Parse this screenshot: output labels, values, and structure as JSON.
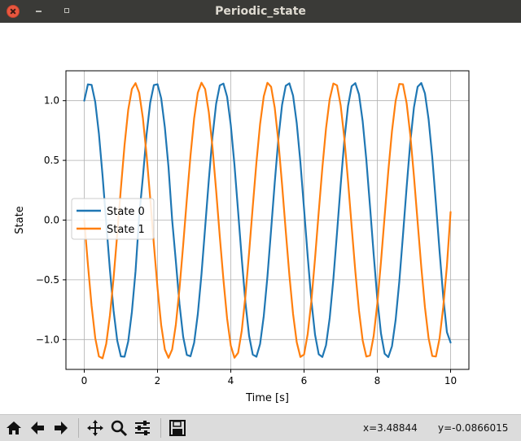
{
  "window": {
    "title": "Periodic_state"
  },
  "toolbar": {
    "x_readout": "x=3.48844",
    "y_readout": "y=-0.0866015",
    "buttons": [
      "home-icon",
      "back-icon",
      "forward-icon",
      "pan-icon",
      "zoom-icon",
      "configure-subplots-icon",
      "save-icon"
    ]
  },
  "chart_data": {
    "type": "line",
    "title": "",
    "xlabel": "Time [s]",
    "ylabel": "State",
    "xlim": [
      -0.5,
      10.5
    ],
    "ylim": [
      -1.25,
      1.25
    ],
    "xticks": [
      0,
      2,
      4,
      6,
      8,
      10
    ],
    "xtick_labels": [
      "0",
      "2",
      "4",
      "6",
      "8",
      "10"
    ],
    "yticks": [
      -1.0,
      -0.5,
      0.0,
      0.5,
      1.0
    ],
    "ytick_labels": [
      "−1.0",
      "−0.5",
      "0.0",
      "0.5",
      "1.0"
    ],
    "grid": true,
    "legend_position": "center-left",
    "colors": {
      "State 0": "#1f77b4",
      "State 1": "#ff7f0e"
    },
    "x": [
      0.0,
      0.1,
      0.2,
      0.3,
      0.4,
      0.5,
      0.6,
      0.7,
      0.8,
      0.9,
      1.0,
      1.1,
      1.2,
      1.3,
      1.4,
      1.5,
      1.6,
      1.7,
      1.8,
      1.9,
      2.0,
      2.1,
      2.2,
      2.3,
      2.4,
      2.5,
      2.6,
      2.7,
      2.8,
      2.9,
      3.0,
      3.1,
      3.2,
      3.3,
      3.4,
      3.5,
      3.6,
      3.7,
      3.8,
      3.9,
      4.0,
      4.1,
      4.2,
      4.3,
      4.4,
      4.5,
      4.6,
      4.7,
      4.8,
      4.9,
      5.0,
      5.1,
      5.2,
      5.3,
      5.4,
      5.5,
      5.6,
      5.7,
      5.8,
      5.9,
      6.0,
      6.1,
      6.2,
      6.3,
      6.4,
      6.5,
      6.6,
      6.7,
      6.8,
      6.9,
      7.0,
      7.1,
      7.2,
      7.3,
      7.4,
      7.5,
      7.6,
      7.7,
      7.8,
      7.9,
      8.0,
      8.1,
      8.2,
      8.3,
      8.4,
      8.5,
      8.6,
      8.7,
      8.8,
      8.9,
      9.0,
      9.1,
      9.2,
      9.3,
      9.4,
      9.5,
      9.6,
      9.7,
      9.8,
      9.9,
      10.0
    ],
    "series": [
      {
        "name": "State 0",
        "values": [
          1.0,
          1.1365,
          1.1323,
          0.9884,
          0.7234,
          0.3712,
          -0.0236,
          -0.4141,
          -0.7572,
          -1.0084,
          -1.1412,
          -1.1438,
          -1.016,
          -0.7697,
          -0.428,
          0.0344,
          0.3588,
          0.7139,
          0.9827,
          1.1305,
          1.1375,
          1.0203,
          0.7767,
          0.4427,
          0.0,
          -0.3441,
          -0.7042,
          -0.9767,
          -1.1285,
          -1.14,
          -1.0263,
          -0.7863,
          -0.4536,
          -0.0609,
          0.3346,
          0.6977,
          0.9731,
          1.1278,
          1.1426,
          1.032,
          0.7954,
          0.4638,
          0.0721,
          -0.3249,
          -0.6907,
          -0.9689,
          -1.1263,
          -1.144,
          -1.0371,
          -0.8038,
          -0.4743,
          -0.0833,
          0.3149,
          0.6833,
          0.9644,
          1.1246,
          1.1449,
          1.0421,
          0.8121,
          0.4846,
          0.0944,
          -0.3049,
          -0.6757,
          -0.9596,
          -1.1228,
          -1.1459,
          -1.0469,
          -0.8202,
          -0.4949,
          -0.1055,
          0.2948,
          0.6679,
          0.9546,
          1.1208,
          1.1467,
          1.0516,
          0.8281,
          0.505,
          0.1166,
          -0.2845,
          -0.6599,
          -0.9494,
          -1.1186,
          -1.1472,
          -1.0561,
          -0.8358,
          -0.515,
          -0.1276,
          0.2742,
          0.6517,
          0.944,
          1.1162,
          1.1475,
          1.0605,
          0.8434,
          0.5249,
          0.1386,
          -0.2638,
          -0.6434,
          -0.9384,
          -1.0252
        ]
      },
      {
        "name": "State 1",
        "values": [
          0.0,
          -0.3718,
          -0.7169,
          -0.9872,
          -1.1414,
          -1.1573,
          -1.0359,
          -0.7996,
          -0.4871,
          -0.1184,
          0.2655,
          0.6282,
          0.9222,
          1.0982,
          1.1467,
          1.0651,
          0.8554,
          0.5495,
          0.1842,
          -0.2008,
          -0.5686,
          -0.8789,
          -1.0831,
          -1.1531,
          -1.0823,
          -0.8756,
          -0.5729,
          -0.2097,
          0.1738,
          0.5388,
          0.8529,
          1.0661,
          1.1502,
          1.0968,
          0.9035,
          0.6102,
          0.2486,
          -0.1378,
          -0.5016,
          -0.8253,
          -1.0516,
          -1.1523,
          -1.1117,
          -0.9248,
          -0.6337,
          -0.2725,
          0.1137,
          0.4829,
          0.8042,
          1.0356,
          1.1495,
          1.1167,
          0.9401,
          0.6554,
          0.2963,
          -0.0896,
          -0.4625,
          -0.7858,
          -1.0223,
          -1.1458,
          -1.1253,
          -0.9532,
          -0.6774,
          -0.3205,
          0.0658,
          0.4394,
          0.7681,
          1.0127,
          1.1433,
          1.1278,
          0.9596,
          0.6846,
          0.3296,
          -0.0558,
          -0.4305,
          -0.7597,
          -1.0074,
          -1.1426,
          -1.1339,
          -0.9712,
          -0.6991,
          -0.3486,
          0.0333,
          0.4103,
          0.7441,
          0.9981,
          1.1393,
          1.1371,
          0.9796,
          0.7134,
          0.3665,
          -0.0148,
          -0.3923,
          -0.7299,
          -0.9892,
          -1.1381,
          -1.1422,
          -0.9889,
          -0.7264,
          -0.3831,
          0.0674
        ]
      }
    ]
  }
}
